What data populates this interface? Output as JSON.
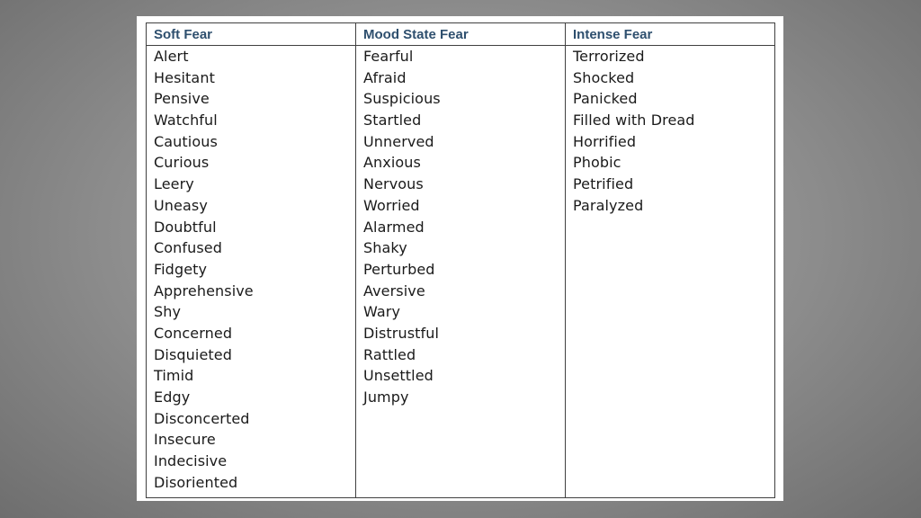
{
  "table": {
    "headers": [
      "Soft Fear",
      "Mood State Fear",
      "Intense Fear"
    ],
    "columns": [
      [
        "Alert",
        "Hesitant",
        "Pensive",
        "Watchful",
        "Cautious",
        "Curious",
        "Leery",
        "Uneasy",
        "Doubtful",
        "Confused",
        "Fidgety",
        "Apprehensive",
        "Shy",
        "Concerned",
        "Disquieted",
        "Timid",
        "Edgy",
        "Disconcerted",
        "Insecure",
        "Indecisive",
        "Disoriented"
      ],
      [
        "Fearful",
        "Afraid",
        "Suspicious",
        "Startled",
        "Unnerved",
        "Anxious",
        "Nervous",
        "Worried",
        "Alarmed",
        "Shaky",
        "Perturbed",
        "Aversive",
        "Wary",
        "Distrustful",
        "Rattled",
        "Unsettled",
        "Jumpy"
      ],
      [
        "Terrorized",
        "Shocked",
        "Panicked",
        "Filled with Dread",
        "Horrified",
        "Phobic",
        "Petrified",
        "Paralyzed"
      ]
    ]
  },
  "colors": {
    "header_text": "#2e4f6e",
    "border": "#404040"
  }
}
